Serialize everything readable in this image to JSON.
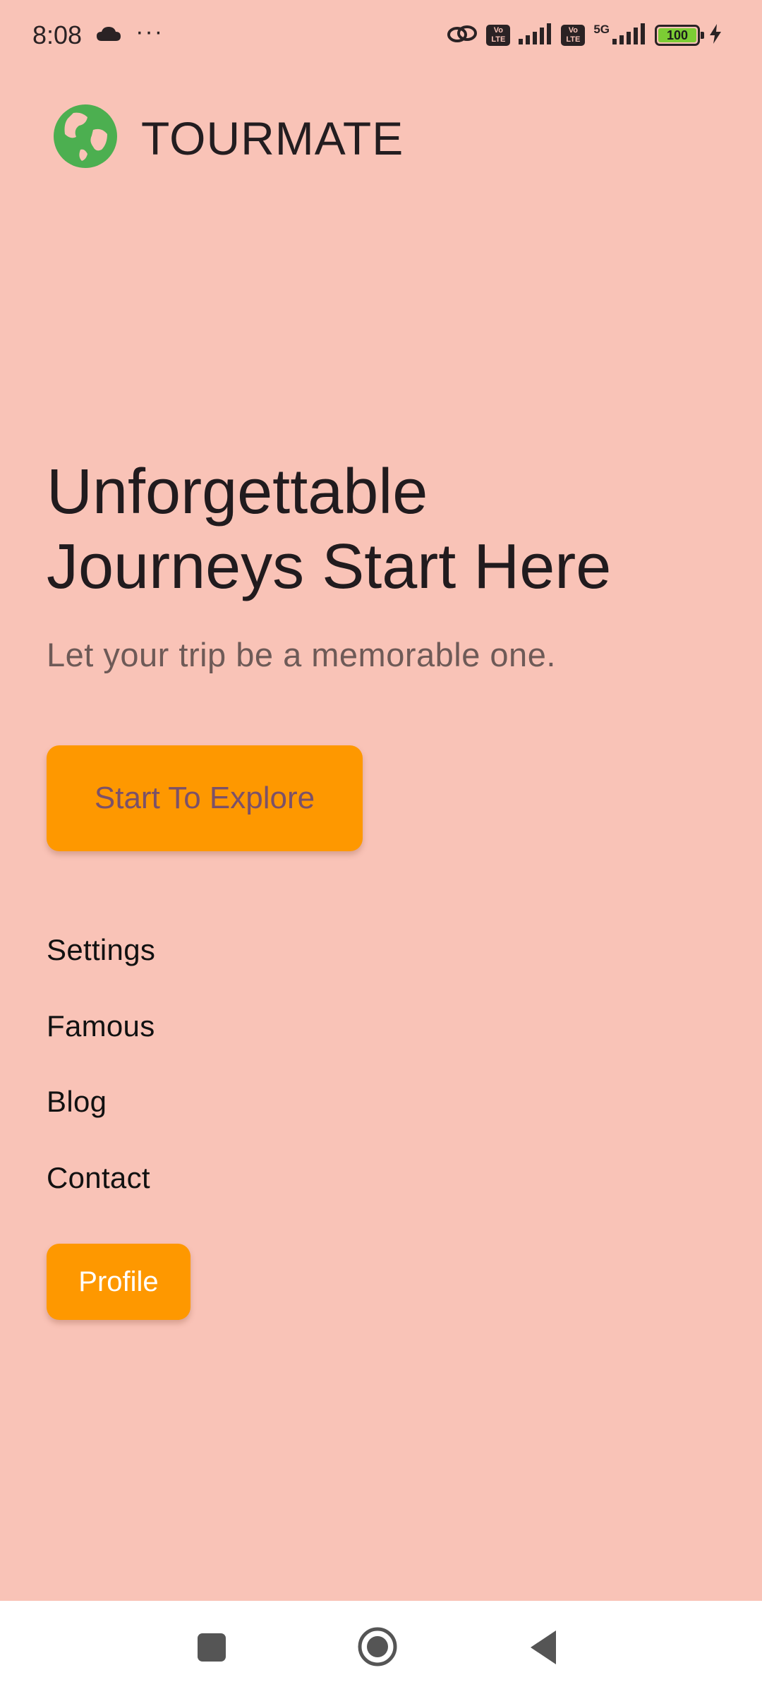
{
  "status_bar": {
    "time": "8:08",
    "more": "···",
    "network": "5G",
    "lte_badge": "Vo LTE",
    "battery": "100",
    "icons": [
      "cloud-icon",
      "link-icon",
      "volte-icon",
      "signal-icon",
      "volte-icon",
      "signal-5g-icon",
      "battery-icon",
      "charging-icon"
    ]
  },
  "header": {
    "logo_icon": "globe-icon",
    "title": "TOURMATE"
  },
  "hero": {
    "title_line1": "Unforgettable",
    "title_line2": "Journeys Start Here",
    "subtitle": "Let your trip be a memorable one.",
    "cta_label": "Start To Explore"
  },
  "menu": {
    "items": [
      {
        "label": "Settings"
      },
      {
        "label": "Famous"
      },
      {
        "label": "Blog"
      },
      {
        "label": "Contact"
      }
    ],
    "profile_label": "Profile"
  },
  "system_nav": {
    "icons": [
      "recents-icon",
      "home-icon",
      "back-icon"
    ]
  },
  "colors": {
    "background": "#f9c3b7",
    "accent": "#fe9800",
    "logo_green": "#4caf50",
    "cta_text": "#7b5169"
  }
}
